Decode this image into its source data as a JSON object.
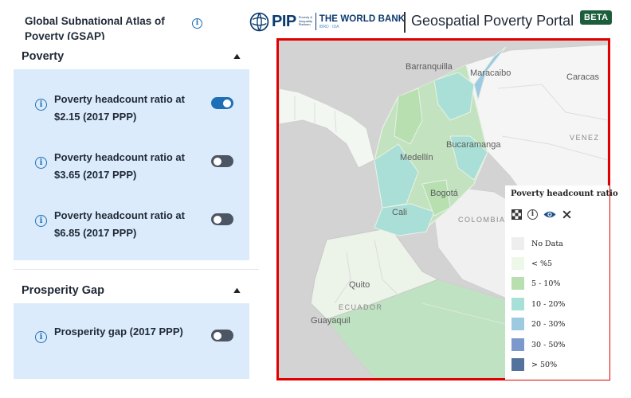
{
  "sidebar": {
    "title": "Global Subnational Atlas of Poverty (GSAP)",
    "sections": [
      {
        "heading": "Poverty",
        "items": [
          {
            "label": "Poverty headcount ratio at $2.15 (2017 PPP)",
            "enabled": true
          },
          {
            "label": "Poverty headcount ratio at $3.65 (2017 PPP)",
            "enabled": false
          },
          {
            "label": "Poverty headcount ratio at $6.85 (2017 PPP)",
            "enabled": false
          }
        ]
      },
      {
        "heading": "Prosperity Gap",
        "items": [
          {
            "label": "Prosperity gap (2017 PPP)",
            "enabled": false
          }
        ]
      }
    ]
  },
  "header": {
    "pip_logo_text": "PIP",
    "pip_logo_sub": "Poverty & Inequality Platform",
    "worldbank_name": "THE WORLD BANK",
    "worldbank_sub": "IBRD · IDA",
    "portal_title": "Geospatial Poverty Portal",
    "badge": "BETA"
  },
  "map": {
    "place_labels": [
      "Barranquilla",
      "Maracaibo",
      "Caracas",
      "Medellín",
      "Bucaramanga",
      "Bogotá",
      "Cali",
      "Quito",
      "Guayaquil"
    ],
    "country_labels": [
      "VENEZ",
      "COLOMBIA",
      "ECUADOR"
    ],
    "legend": {
      "title": "Poverty headcount ratio",
      "tools": [
        "checkerboard-icon",
        "info-icon",
        "eye-icon",
        "close-icon"
      ],
      "classes": [
        {
          "label": "No Data",
          "color": "#eeeeee"
        },
        {
          "label": "< %5",
          "color": "#edf8e9"
        },
        {
          "label": "5 - 10%",
          "color": "#b7dfb0"
        },
        {
          "label": "10 - 20%",
          "color": "#a7e0d8"
        },
        {
          "label": "20 - 30%",
          "color": "#9ecae1"
        },
        {
          "label": "30 - 50%",
          "color": "#7b99cd"
        },
        {
          "label": "> 50%",
          "color": "#54739c"
        }
      ]
    }
  },
  "colors": {
    "accent": "#1e6fb8",
    "panel_bg": "#dcebfb",
    "badge_bg": "#1b5e3b",
    "map_highlight_border": "#e00000"
  }
}
